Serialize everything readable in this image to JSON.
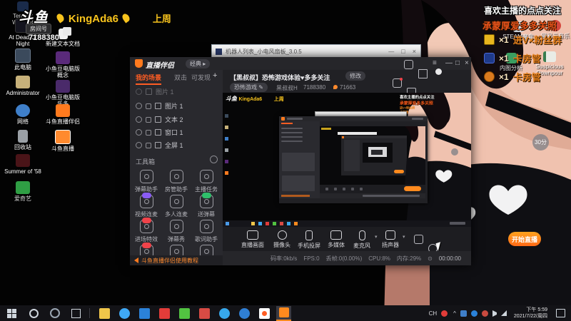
{
  "colors": {
    "accent_orange": "#ff6a17",
    "brand_yellow": "#f7c31d",
    "tab_active": "#ff5d23",
    "notice_orange": "#e8821e"
  },
  "watermark": {
    "logo": "斗鱼",
    "streamer": "KingAda6",
    "period": "上周",
    "room_label": "房间号",
    "room_number": "7188380"
  },
  "notice": {
    "line1": "喜欢主播的点点关注",
    "line2": "承蒙厚爱多多关照",
    "perks": [
      {
        "icon": "pencil-badge",
        "count": "×1",
        "label": "进V×粉丝群"
      },
      {
        "icon": "shield-badge",
        "count": "×1",
        "label": "卡房管"
      },
      {
        "icon": "medal-badge",
        "count": "×1",
        "label": "卡房管"
      }
    ]
  },
  "desktop": {
    "wemeet_label": "Tencent WeMeet",
    "icons_left_col1": [
      "At Dead Of Night",
      "此电脑",
      "Administrator",
      "网络",
      "回收站",
      "Summer of '58",
      "爱奇艺"
    ],
    "icons_left_col2": [
      "新建文本文档",
      "小鱼豆电脑版概念",
      "小鱼豆电脑版乐多",
      "斗鱼直播伴侣",
      "斗鱼直播"
    ],
    "icons_right": [
      "STEAM魔盒",
      "网易云音乐",
      "内图分析",
      "Suspicious Downpour"
    ],
    "arm_badge": "30分"
  },
  "robot_window": {
    "title": "机器人列表_小电风扇板_3.0.5",
    "controls": [
      "—",
      "□",
      "×"
    ]
  },
  "studio": {
    "app_name": "直播伴侣",
    "mode_pill": "经典 ▸",
    "window_controls": [
      "—",
      "□",
      "×"
    ],
    "scene_tabs": [
      {
        "label": "我的场景"
      },
      {
        "label": "双击"
      },
      {
        "label": "可发现"
      }
    ],
    "add_scene": "+",
    "muted_row": "图片 1",
    "sources": [
      {
        "icon": "image-icon",
        "label": "图片 1"
      },
      {
        "icon": "text-icon",
        "label": "文本 2"
      },
      {
        "icon": "window-icon",
        "label": "窗口 1"
      },
      {
        "icon": "fullscreen-icon",
        "label": "全屏 1"
      }
    ],
    "toolbox_label": "工具箱",
    "tools": [
      {
        "label": "弹幕助手"
      },
      {
        "label": "房管助手"
      },
      {
        "label": "主播任务"
      },
      {
        "label": "视频连麦",
        "badge_color": "#8a5cf5"
      },
      {
        "label": "多人连麦"
      },
      {
        "label": "送弹幕",
        "badge_color": "#2fbf6b"
      },
      {
        "label": "进场特效",
        "badge_color": "#f0434a"
      },
      {
        "label": "弹幕秀"
      },
      {
        "label": "歌词助手"
      },
      {
        "label": "",
        "badge_color": "#f0434a"
      },
      {
        "label": ""
      },
      {
        "label": ""
      }
    ],
    "tutorial": "斗鱼直播伴侣使用教程",
    "room_title": "【黑叔叔】恐怖游戏体验♥多多关注",
    "edit_button": "修改",
    "category": "恐怖游戏 ✎",
    "streamer_id": "黑叔叔H",
    "room_number": "7188380",
    "heat": "71663",
    "controls": [
      {
        "label": "直播画面"
      },
      {
        "label": "摄像头"
      },
      {
        "label": "手机投屏"
      },
      {
        "label": "多媒体"
      },
      {
        "label": "麦克风",
        "dropdown": true
      },
      {
        "label": "扬声器",
        "dropdown": true
      }
    ],
    "start_button": "开始直播",
    "status": {
      "bitrate": "码率:0kb/s",
      "fps": "FPS:0",
      "dropped": "丢帧:0(0.00%)",
      "cpu": "CPU:8%",
      "mem": "内存:29%",
      "clock": "⊙",
      "duration": "00:00:00"
    }
  },
  "taskbar": {
    "lang": "CH",
    "time": "下午 5:59",
    "date": "2021/7/22/周四"
  }
}
